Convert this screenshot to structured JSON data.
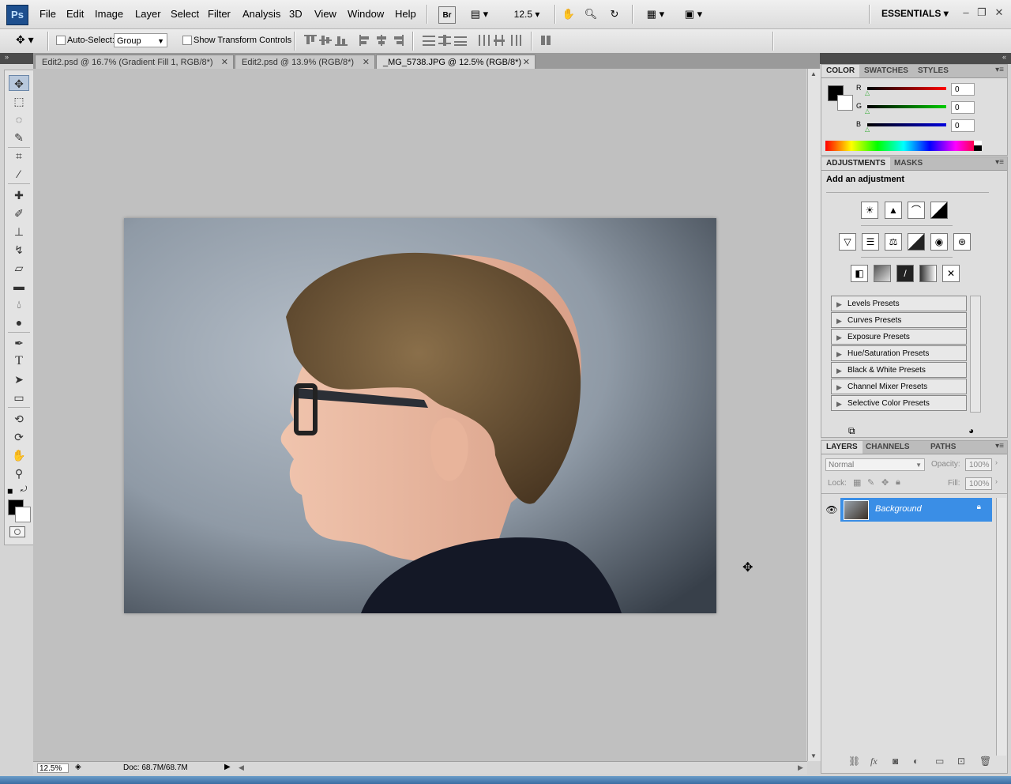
{
  "app": {
    "logo": "Ps"
  },
  "menu": [
    "File",
    "Edit",
    "Image",
    "Layer",
    "Select",
    "Filter",
    "Analysis",
    "3D",
    "View",
    "Window",
    "Help"
  ],
  "toolbar": {
    "bridge": "Br",
    "zoom": "12.5",
    "workspace": "ESSENTIALS"
  },
  "options": {
    "auto_select_label": "Auto-Select:",
    "auto_select_value": "Group",
    "transform_label": "Show Transform Controls"
  },
  "tabs": [
    {
      "label": "Edit2.psd @ 16.7% (Gradient Fill 1, RGB/8*)"
    },
    {
      "label": "Edit2.psd @ 13.9% (RGB/8*)"
    },
    {
      "label": "_MG_5738.JPG @ 12.5% (RGB/8*)"
    }
  ],
  "status": {
    "zoom": "12.5%",
    "doc": "Doc: 68.7M/68.7M"
  },
  "color_panel": {
    "tabs": [
      "COLOR",
      "SWATCHES",
      "STYLES"
    ],
    "channels": [
      {
        "label": "R",
        "value": "0",
        "color": "#e00000"
      },
      {
        "label": "G",
        "value": "0",
        "color": "#00c000"
      },
      {
        "label": "B",
        "value": "0",
        "color": "#0000d0"
      }
    ]
  },
  "adjustments_panel": {
    "tabs": [
      "ADJUSTMENTS",
      "MASKS"
    ],
    "heading": "Add an adjustment",
    "presets": [
      "Levels Presets",
      "Curves Presets",
      "Exposure Presets",
      "Hue/Saturation Presets",
      "Black & White Presets",
      "Channel Mixer Presets",
      "Selective Color Presets"
    ]
  },
  "layers_panel": {
    "tabs": [
      "LAYERS",
      "CHANNELS",
      "PATHS"
    ],
    "blend_mode": "Normal",
    "opacity_label": "Opacity:",
    "opacity": "100%",
    "lock_label": "Lock:",
    "fill_label": "Fill:",
    "fill": "100%",
    "layers": [
      {
        "name": "Background"
      }
    ]
  },
  "colors": {
    "accent_blue": "#3a8ee6",
    "canvas_bg": "#c0c0c0"
  }
}
